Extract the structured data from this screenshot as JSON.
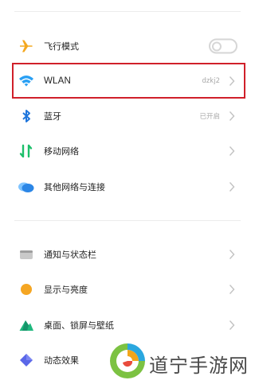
{
  "settings": {
    "section1": [
      {
        "label": "飞行模式",
        "icon": "airplane-icon",
        "control": "toggle",
        "toggle_on": false
      },
      {
        "label": "WLAN",
        "icon": "wifi-icon",
        "value": "dzkj2"
      },
      {
        "label": "蓝牙",
        "icon": "bluetooth-icon",
        "value": "已开启"
      },
      {
        "label": "移动网络",
        "icon": "mobile-network-icon"
      },
      {
        "label": "其他网络与连接",
        "icon": "cloud-icon"
      }
    ],
    "section2": [
      {
        "label": "通知与状态栏",
        "icon": "notification-icon"
      },
      {
        "label": "显示与亮度",
        "icon": "brightness-icon"
      },
      {
        "label": "桌面、锁屏与壁纸",
        "icon": "wallpaper-icon"
      },
      {
        "label": "动态效果",
        "icon": "motion-effects-icon"
      }
    ]
  },
  "highlight_color": "#d0202a",
  "watermark": {
    "text": "道宁手游网",
    "icon": "watermark-logo-icon"
  }
}
